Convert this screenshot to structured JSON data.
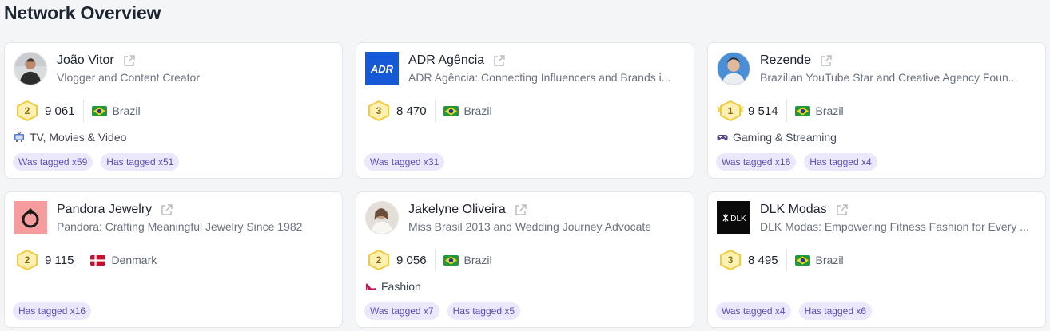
{
  "page": {
    "title": "Network Overview"
  },
  "colors": {
    "tag_bg": "#ebe8fb",
    "tag_text": "#5b4fb8",
    "badge_gold": "#f5d24a"
  },
  "cards": [
    {
      "name": "João Vitor",
      "description": "Vlogger and Content Creator",
      "avatar_icon": "person-photo",
      "rank": "2",
      "score": "9 061",
      "country": "Brazil",
      "flag_icon": "brazil-flag-icon",
      "category": "TV, Movies & Video",
      "category_icon": "tv-icon",
      "tags": [
        "Was tagged x59",
        "Has tagged x51"
      ]
    },
    {
      "name": "ADR Agência",
      "description": "ADR Agência: Connecting Influencers and Brands i...",
      "avatar_icon": "adr-logo",
      "avatar_text": "ADR",
      "rank": "3",
      "score": "8 470",
      "country": "Brazil",
      "flag_icon": "brazil-flag-icon",
      "category": "",
      "tags": [
        "Was tagged x31"
      ]
    },
    {
      "name": "Rezende",
      "description": "Brazilian YouTube Star and Creative Agency Foun...",
      "avatar_icon": "person-photo",
      "rank": "1",
      "score": "9 514",
      "country": "Brazil",
      "flag_icon": "brazil-flag-icon",
      "category": "Gaming & Streaming",
      "category_icon": "gamepad-icon",
      "tags": [
        "Was tagged x16",
        "Has tagged x4"
      ]
    },
    {
      "name": "Pandora Jewelry",
      "description": "Pandora: Crafting Meaningful Jewelry Since 1982",
      "avatar_icon": "pandora-ring-logo",
      "rank": "2",
      "score": "9 115",
      "country": "Denmark",
      "flag_icon": "denmark-flag-icon",
      "category": "",
      "tags": [
        "Has tagged x16"
      ]
    },
    {
      "name": "Jakelyne Oliveira",
      "description": "Miss Brasil 2013 and Wedding Journey Advocate",
      "avatar_icon": "person-photo",
      "rank": "2",
      "score": "9 056",
      "country": "Brazil",
      "flag_icon": "brazil-flag-icon",
      "category": "Fashion",
      "category_icon": "high-heel-icon",
      "tags": [
        "Was tagged x7",
        "Has tagged x5"
      ]
    },
    {
      "name": "DLK Modas",
      "description": "DLK Modas: Empowering Fitness Fashion for Every ...",
      "avatar_icon": "dlk-logo",
      "avatar_text": "DLK",
      "rank": "3",
      "score": "8 495",
      "country": "Brazil",
      "flag_icon": "brazil-flag-icon",
      "category": "",
      "tags": [
        "Was tagged x4",
        "Has tagged x6"
      ]
    }
  ]
}
